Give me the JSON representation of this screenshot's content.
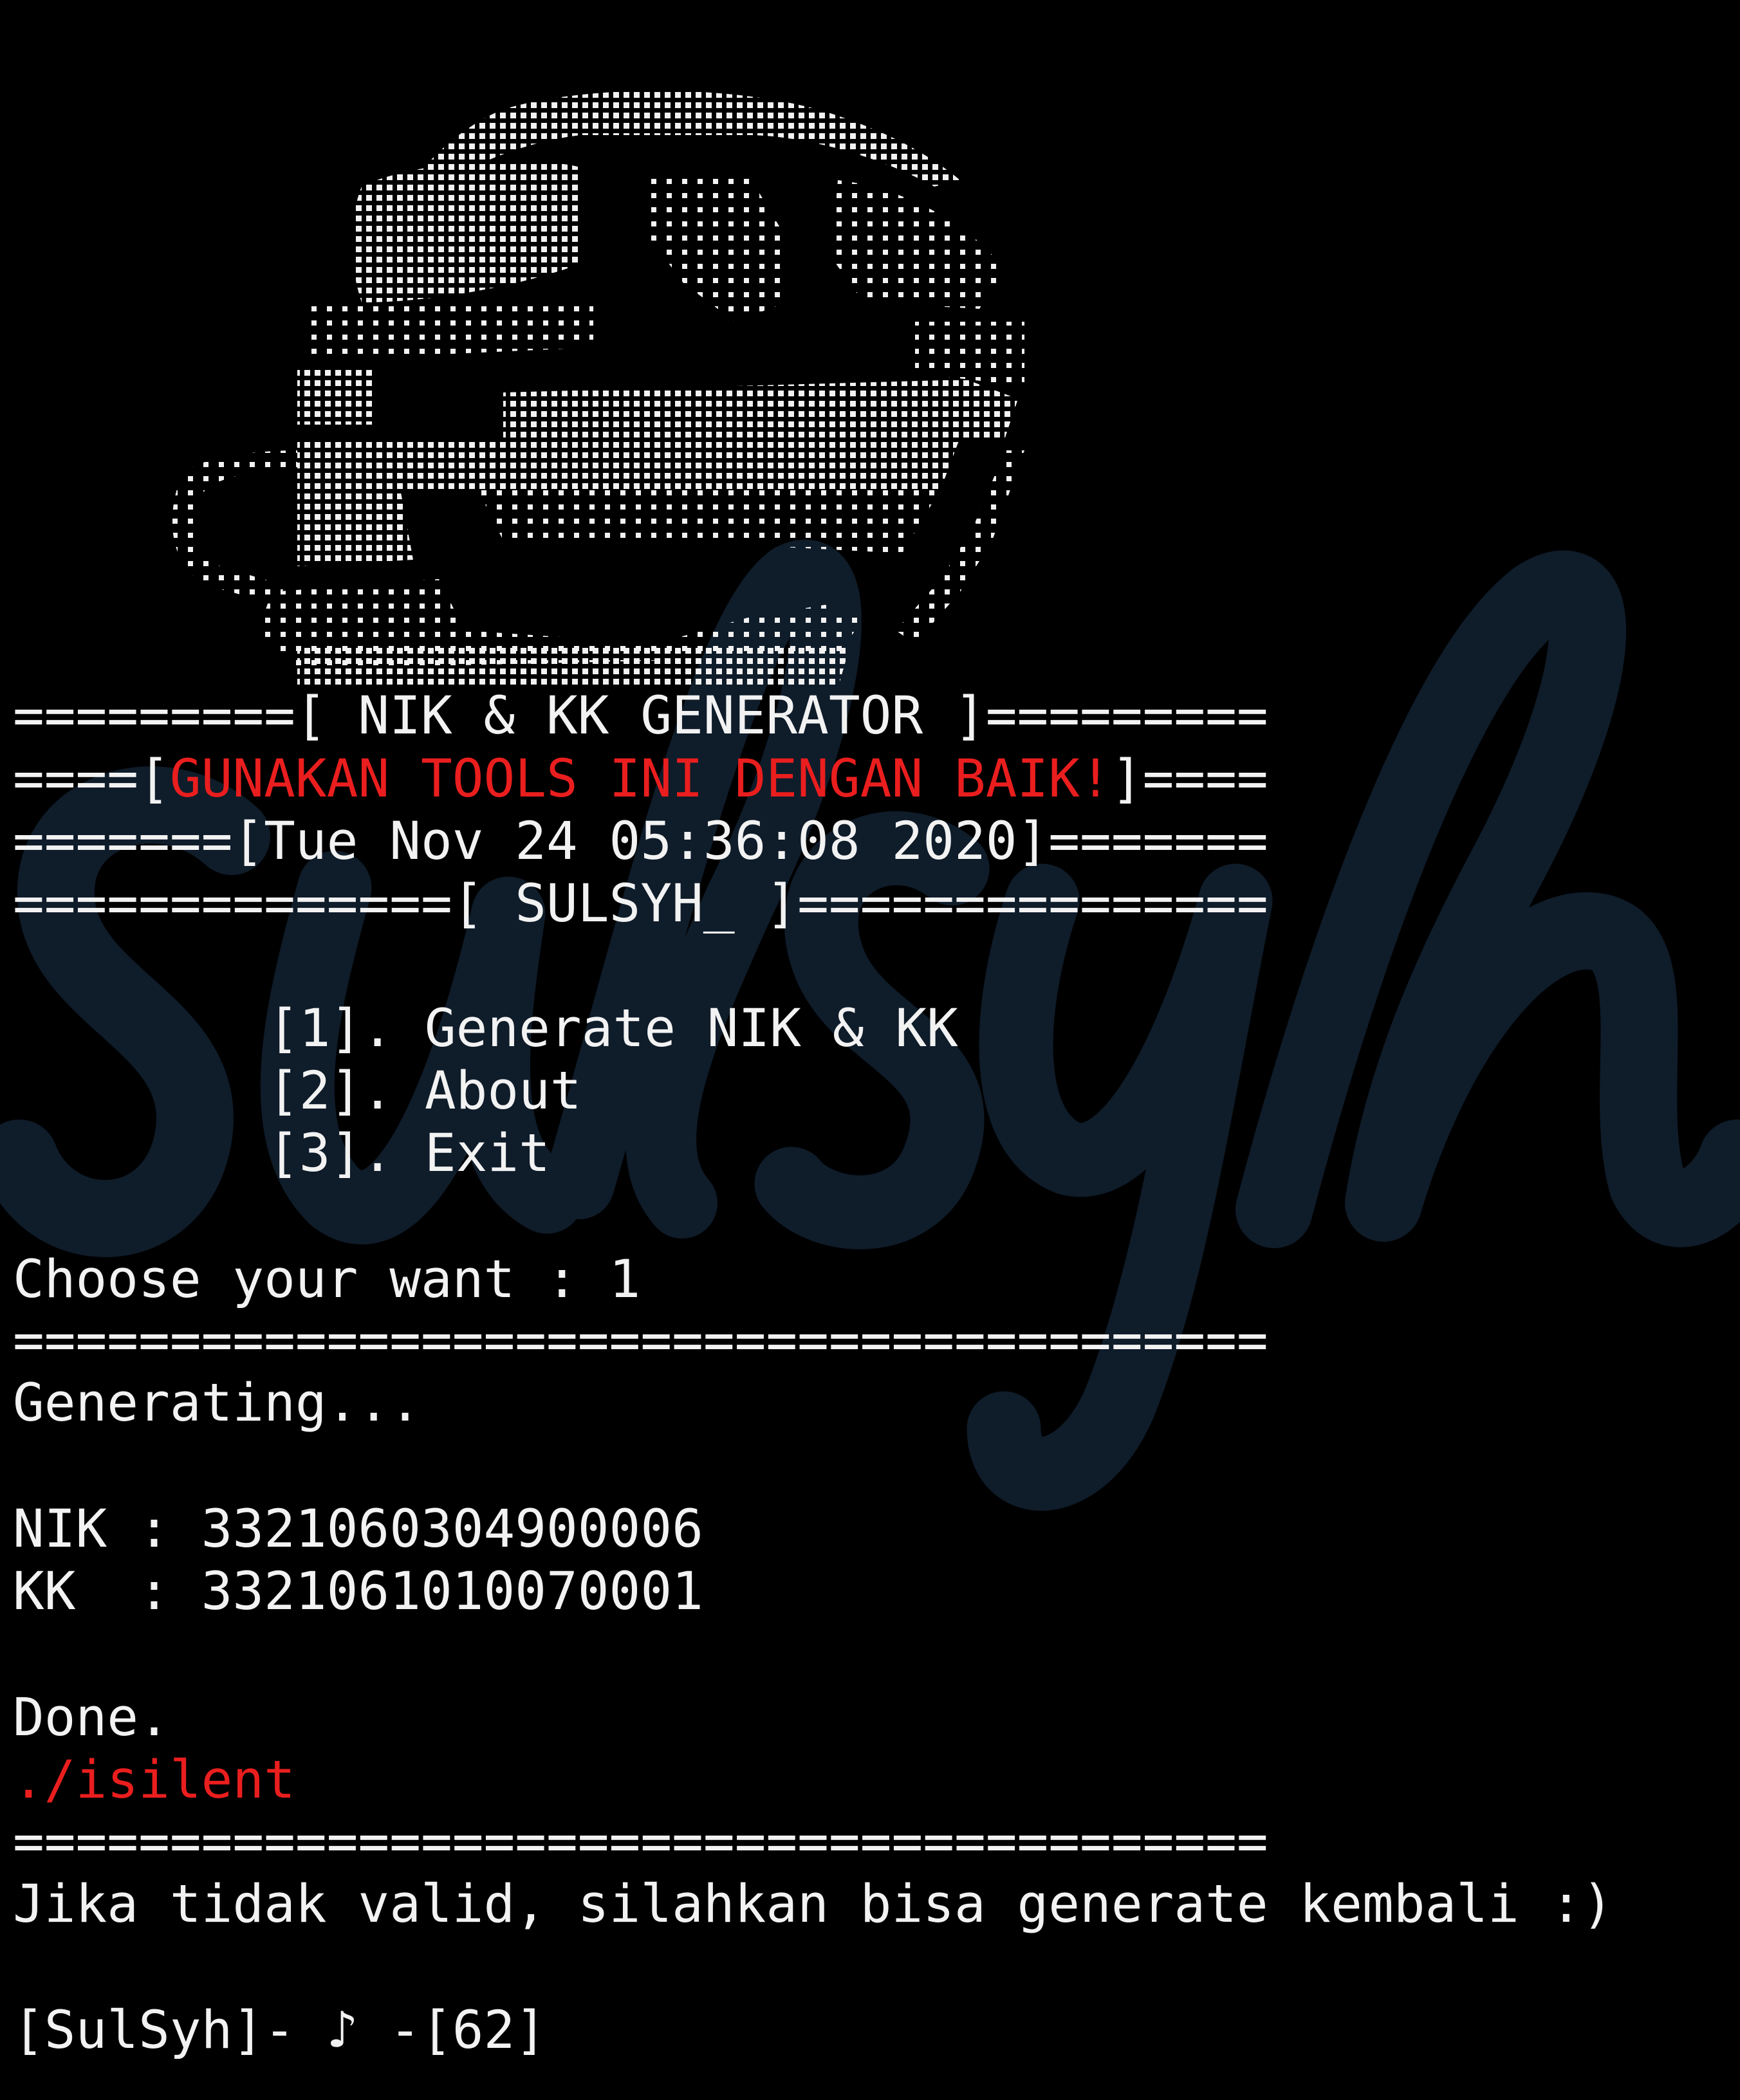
{
  "colors": {
    "background": "#000000",
    "text": "#f2f2f2",
    "accent_red": "#ea1e1e",
    "watermark": "#0f1c2a"
  },
  "banner": {
    "logo_icon": "ascii-globe-cup-logo",
    "title_line": "=========[ NIK & KK GENERATOR ]=========",
    "warning_prefix": "====[",
    "warning_text": "GUNAKAN TOOLS INI DENGAN BAIK!",
    "warning_suffix": "]====",
    "date_line": "=======[Tue Nov 24 05:36:08 2020]=======",
    "author_line": "==============[ SULSYH_ ]==============="
  },
  "menu": {
    "items": [
      "[1]. Generate NIK & KK",
      "[2]. About",
      "[3]. Exit"
    ]
  },
  "prompt": {
    "text": "Choose your want : 1"
  },
  "separator": "========================================",
  "output": {
    "generating": "Generating...",
    "nik_line": "NIK : 3321060304900006",
    "kk_line": "KK  : 3321061010070001",
    "done": "Done.",
    "script_name": "./isilent",
    "note": "Jika tidak valid, silahkan bisa generate kembali :)"
  },
  "shell_prompt": "[SulSyh]- ♪ -[62]",
  "watermark_text": "sulsyh"
}
